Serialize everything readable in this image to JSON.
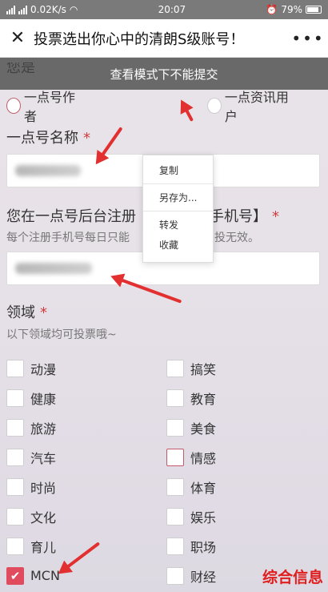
{
  "status_bar": {
    "network_speed": "0.02K/s",
    "time": "20:07",
    "battery": "79%"
  },
  "title_bar": {
    "title": "投票选出你心中的清朗S级账号！",
    "more_label": "•••",
    "close_label": "✕"
  },
  "banner": {
    "text": "查看模式下不能提交"
  },
  "prev_question": {
    "partial_label": "您是",
    "options": [
      "一点号作者",
      "一点资讯用户"
    ]
  },
  "account_name": {
    "label": "一点号名称",
    "required": "*"
  },
  "phone": {
    "label_start": "您在一点号后台注册",
    "label_end": "手机号】",
    "required": "*",
    "hint_start": "每个注册手机号每日只能",
    "hint_end": "多投无效。"
  },
  "context_menu": {
    "items": [
      "复制",
      "另存为...",
      "转发",
      "收藏"
    ]
  },
  "domain_field": {
    "label": "领域",
    "required": "*",
    "hint": "以下领域均可投票哦~",
    "options": [
      [
        "动漫",
        "搞笑"
      ],
      [
        "健康",
        "教育"
      ],
      [
        "旅游",
        "美食"
      ],
      [
        "汽车",
        "情感"
      ],
      [
        "时尚",
        "体育"
      ],
      [
        "文化",
        "娱乐"
      ],
      [
        "育儿",
        "职场"
      ],
      [
        "MCN",
        "财经"
      ]
    ],
    "checked": "MCN"
  },
  "watermark": {
    "text": "综合信息"
  },
  "colors": {
    "accent": "#e04b5e",
    "arrow": "#e23030",
    "banner": "#464646"
  }
}
